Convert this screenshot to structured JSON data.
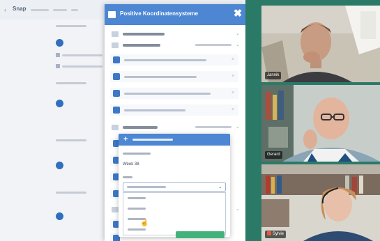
{
  "app": {
    "back_glyph": "‹",
    "logo_text": "Snap",
    "timeline_dots": 4
  },
  "panel": {
    "title": "Positive Koordinatensysteme",
    "close_glyph": "✖",
    "accent_color": "#4d86d3",
    "sections": [
      {
        "title": "",
        "chevron": "⌄"
      },
      {
        "title": "",
        "chevron": "⌄"
      },
      {
        "title": "",
        "chevron": "⌄"
      },
      {
        "title": "",
        "chevron": "⌄"
      }
    ]
  },
  "popup": {
    "header_icon": "+",
    "value_1": "Week 38",
    "select_arrow": "⌄",
    "options": [
      "",
      "",
      "",
      ""
    ]
  },
  "videos": [
    {
      "name": "Jannik"
    },
    {
      "name": "Gerard"
    },
    {
      "name": "Sylvie",
      "muted": true
    }
  ],
  "colors": {
    "video_bg": "#2b7a67",
    "checkbox": "#3d78c7",
    "action_green": "#43b27a"
  }
}
